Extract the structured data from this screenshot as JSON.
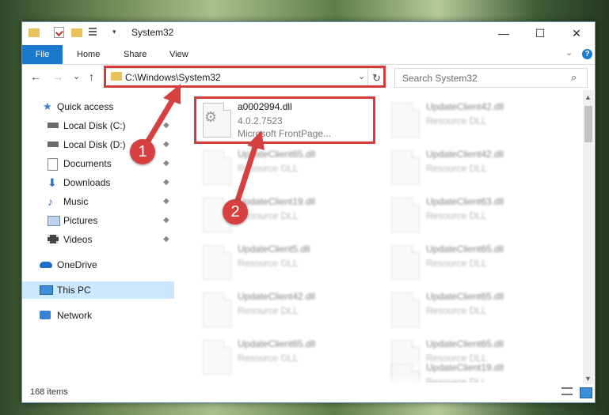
{
  "window": {
    "title": "System32"
  },
  "window_controls": {
    "minimize": "—",
    "maximize": "☐",
    "close": "✕"
  },
  "ribbon": {
    "file": "File",
    "home": "Home",
    "share": "Share",
    "view": "View",
    "chevron": "⌄",
    "help": "?"
  },
  "nav": {
    "back": "←",
    "forward": "→",
    "recent": "⌄",
    "up": "↑"
  },
  "address": {
    "path": "C:\\Windows\\System32",
    "dropdown": "⌄",
    "refresh": "↻"
  },
  "search": {
    "placeholder": "Search System32",
    "icon": "⌕"
  },
  "sidebar": {
    "items": [
      {
        "label": "Quick access",
        "icon": "star-icon",
        "pinned": false
      },
      {
        "label": "Local Disk (C:)",
        "icon": "drive-icon",
        "pinned": true
      },
      {
        "label": "Local Disk (D:)",
        "icon": "drive-icon",
        "pinned": true
      },
      {
        "label": "Documents",
        "icon": "documents-icon",
        "pinned": true
      },
      {
        "label": "Downloads",
        "icon": "downloads-icon",
        "pinned": true
      },
      {
        "label": "Music",
        "icon": "music-icon",
        "pinned": true
      },
      {
        "label": "Pictures",
        "icon": "pictures-icon",
        "pinned": true
      },
      {
        "label": "Videos",
        "icon": "videos-icon",
        "pinned": true
      },
      {
        "label": "OneDrive",
        "icon": "onedrive-icon",
        "pinned": false
      },
      {
        "label": "This PC",
        "icon": "pc-icon",
        "pinned": false,
        "selected": true
      },
      {
        "label": "Network",
        "icon": "network-icon",
        "pinned": false
      }
    ],
    "pin_glyph": "📌"
  },
  "files": {
    "highlighted": {
      "name": "a0002994.dll",
      "version": "4.0.2.7523",
      "description": "Microsoft FrontPage..."
    },
    "left_column": [
      {
        "name": "UpdateClient65.dll",
        "type": "Resource DLL"
      },
      {
        "name": "UpdateClient19.dll",
        "type": "Resource DLL"
      },
      {
        "name": "UpdateClient5.dll",
        "type": "Resource DLL"
      },
      {
        "name": "UpdateClient42.dll",
        "type": "Resource DLL"
      },
      {
        "name": "UpdateClient65.dll",
        "type": "Resource DLL"
      }
    ],
    "right_column": [
      {
        "name": "UpdateClient42.dll",
        "type": "Resource DLL"
      },
      {
        "name": "UpdateClient42.dll",
        "type": "Resource DLL"
      },
      {
        "name": "UpdateClient63.dll",
        "type": "Resource DLL"
      },
      {
        "name": "UpdateClient65.dll",
        "type": "Resource DLL"
      },
      {
        "name": "UpdateClient65.dll",
        "type": "Resource DLL"
      },
      {
        "name": "UpdateClient65.dll",
        "type": "Resource DLL"
      },
      {
        "name": "UpdateClient19.dll",
        "type": "Resource DLL"
      }
    ]
  },
  "annotations": {
    "step1": "1",
    "step2": "2",
    "color": "#d43b3b"
  },
  "status": {
    "count": "168 items"
  }
}
